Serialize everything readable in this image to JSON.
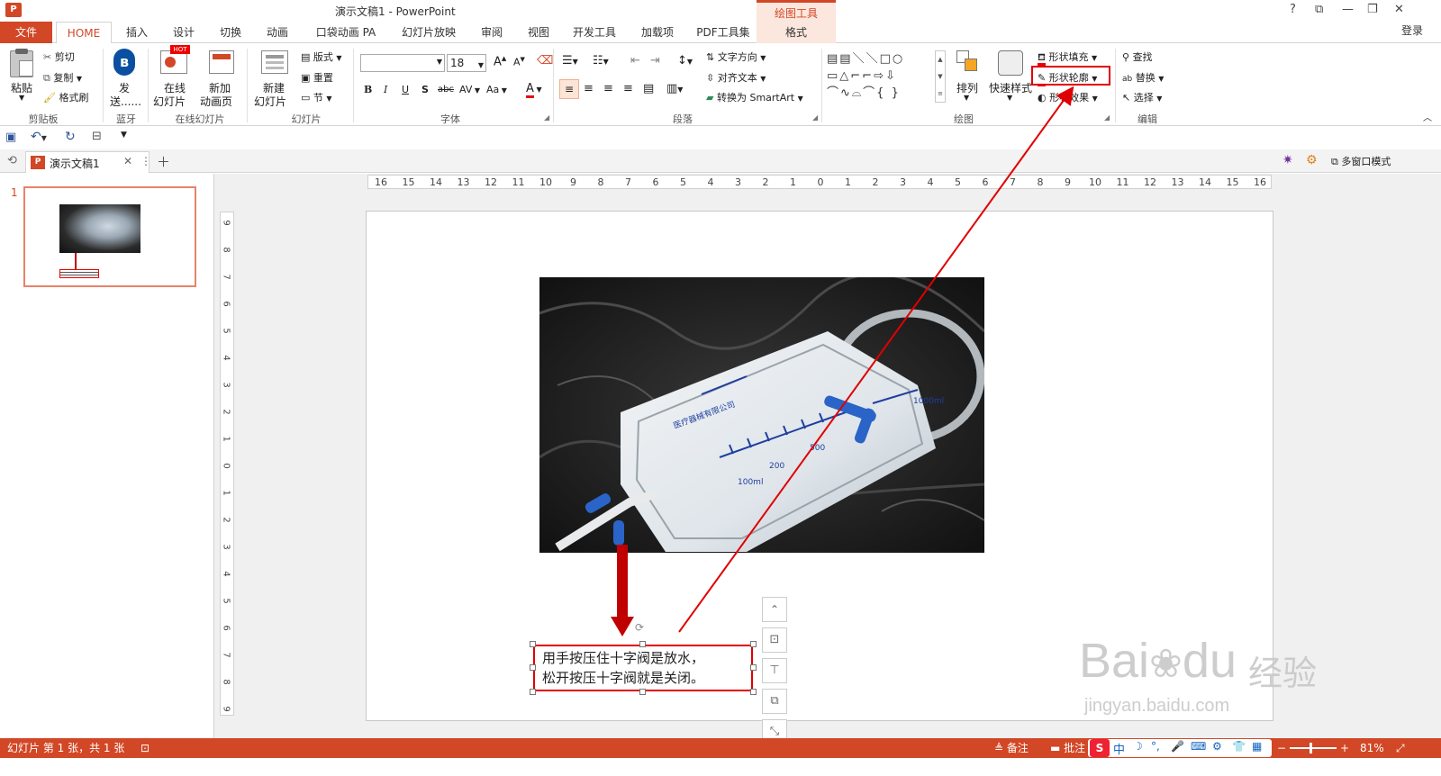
{
  "window": {
    "title": "演示文稿1 - PowerPoint",
    "context_tab_group": "绘图工具",
    "login": "登录",
    "controls": [
      "?",
      "⧉",
      "—",
      "❐",
      "✕"
    ]
  },
  "tabs": [
    "文件",
    "HOME",
    "插入",
    "设计",
    "切换",
    "动画",
    "口袋动画 PA",
    "幻灯片放映",
    "审阅",
    "视图",
    "开发工具",
    "加载项",
    "PDF工具集",
    "格式"
  ],
  "ribbon": {
    "clipboard": {
      "paste": "粘贴",
      "cut": "剪切",
      "copy": "复制",
      "format_painter": "格式刷",
      "label": "剪贴板"
    },
    "bluetooth": {
      "send1": "发",
      "send2": "送......",
      "label": "蓝牙"
    },
    "online": {
      "online1": "在线",
      "online2": "幻灯片",
      "new1": "新加",
      "new2": "动画页",
      "hot": "HOT",
      "label": "在线幻灯片"
    },
    "slides": {
      "new1": "新建",
      "new2": "幻灯片",
      "layout": "版式",
      "reset": "重置",
      "section": "节",
      "label": "幻灯片"
    },
    "font": {
      "name": "",
      "size": "18",
      "bold": "B",
      "italic": "I",
      "underline": "U",
      "shadow": "S",
      "strike": "abc",
      "spacing": "AV",
      "case": "Aa",
      "color": "A",
      "grow": "A",
      "shrink": "A",
      "label": "字体"
    },
    "paragraph": {
      "direction": "文字方向",
      "align": "对齐文本",
      "smartart": "转换为 SmartArt",
      "label": "段落"
    },
    "drawing": {
      "arrange": "排列",
      "quick_styles": "快速样式",
      "fill": "形状填充",
      "outline": "形状轮廓",
      "effects": "形状效果",
      "label": "绘图"
    },
    "editing": {
      "find": "查找",
      "replace": "替换",
      "select": "选择",
      "label": "编辑"
    }
  },
  "doc_tab": {
    "name": "演示文稿1",
    "multiwindow": "多窗口模式"
  },
  "ruler": {
    "h_ticks": [
      "16",
      "15",
      "14",
      "13",
      "12",
      "11",
      "10",
      "9",
      "8",
      "7",
      "6",
      "5",
      "4",
      "3",
      "2",
      "1",
      "0",
      "1",
      "2",
      "3",
      "4",
      "5",
      "6",
      "7",
      "8",
      "9",
      "10",
      "11",
      "12",
      "13",
      "14",
      "15",
      "16"
    ],
    "v_ticks": [
      "9",
      "8",
      "7",
      "6",
      "5",
      "4",
      "3",
      "2",
      "1",
      "0",
      "1",
      "2",
      "3",
      "4",
      "5",
      "6",
      "7",
      "8",
      "9"
    ]
  },
  "slide": {
    "number": "1",
    "textbox_line1": "用手按压住十字阀是放水，",
    "textbox_line2": "松开按压十字阀就是关闭。"
  },
  "photo_text": {
    "scale_1000": "1000ml",
    "scale_500": "500",
    "scale_200": "200",
    "scale_100": "100ml",
    "bag_text": "医疗器械有限公司"
  },
  "statusbar": {
    "slide_info": "幻灯片 第 1 张，共 1 张",
    "notes": "备注",
    "comments": "批注",
    "ime_s": "S",
    "ime_zh": "中",
    "zoom": "81%"
  },
  "watermark": {
    "brand": "Bai",
    "brand2": "du",
    "jingyan": "经验",
    "url": "jingyan.baidu.com"
  },
  "colors": {
    "accent": "#d24726",
    "annotation_red": "#e00000",
    "arrow_red": "#c00000"
  }
}
